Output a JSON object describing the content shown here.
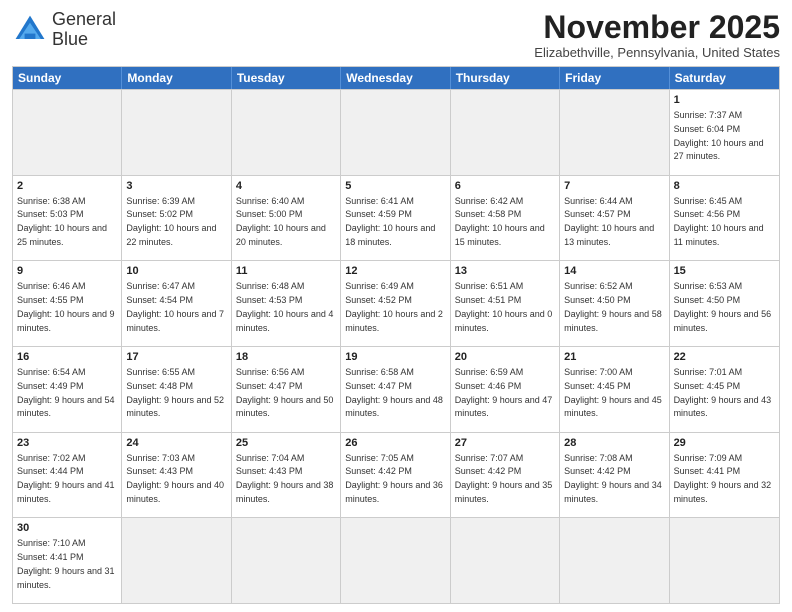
{
  "header": {
    "logo_line1": "General",
    "logo_line2": "Blue",
    "month_title": "November 2025",
    "location": "Elizabethville, Pennsylvania, United States"
  },
  "day_headers": [
    "Sunday",
    "Monday",
    "Tuesday",
    "Wednesday",
    "Thursday",
    "Friday",
    "Saturday"
  ],
  "weeks": [
    [
      {
        "day": "",
        "empty": true
      },
      {
        "day": "",
        "empty": true
      },
      {
        "day": "",
        "empty": true
      },
      {
        "day": "",
        "empty": true
      },
      {
        "day": "",
        "empty": true
      },
      {
        "day": "",
        "empty": true
      },
      {
        "day": "1",
        "sunrise": "7:37 AM",
        "sunset": "6:04 PM",
        "daylight": "10 hours and 27 minutes."
      }
    ],
    [
      {
        "day": "2",
        "sunrise": "6:38 AM",
        "sunset": "5:03 PM",
        "daylight": "10 hours and 25 minutes."
      },
      {
        "day": "3",
        "sunrise": "6:39 AM",
        "sunset": "5:02 PM",
        "daylight": "10 hours and 22 minutes."
      },
      {
        "day": "4",
        "sunrise": "6:40 AM",
        "sunset": "5:00 PM",
        "daylight": "10 hours and 20 minutes."
      },
      {
        "day": "5",
        "sunrise": "6:41 AM",
        "sunset": "4:59 PM",
        "daylight": "10 hours and 18 minutes."
      },
      {
        "day": "6",
        "sunrise": "6:42 AM",
        "sunset": "4:58 PM",
        "daylight": "10 hours and 15 minutes."
      },
      {
        "day": "7",
        "sunrise": "6:44 AM",
        "sunset": "4:57 PM",
        "daylight": "10 hours and 13 minutes."
      },
      {
        "day": "8",
        "sunrise": "6:45 AM",
        "sunset": "4:56 PM",
        "daylight": "10 hours and 11 minutes."
      }
    ],
    [
      {
        "day": "9",
        "sunrise": "6:46 AM",
        "sunset": "4:55 PM",
        "daylight": "10 hours and 9 minutes."
      },
      {
        "day": "10",
        "sunrise": "6:47 AM",
        "sunset": "4:54 PM",
        "daylight": "10 hours and 7 minutes."
      },
      {
        "day": "11",
        "sunrise": "6:48 AM",
        "sunset": "4:53 PM",
        "daylight": "10 hours and 4 minutes."
      },
      {
        "day": "12",
        "sunrise": "6:49 AM",
        "sunset": "4:52 PM",
        "daylight": "10 hours and 2 minutes."
      },
      {
        "day": "13",
        "sunrise": "6:51 AM",
        "sunset": "4:51 PM",
        "daylight": "10 hours and 0 minutes."
      },
      {
        "day": "14",
        "sunrise": "6:52 AM",
        "sunset": "4:50 PM",
        "daylight": "9 hours and 58 minutes."
      },
      {
        "day": "15",
        "sunrise": "6:53 AM",
        "sunset": "4:50 PM",
        "daylight": "9 hours and 56 minutes."
      }
    ],
    [
      {
        "day": "16",
        "sunrise": "6:54 AM",
        "sunset": "4:49 PM",
        "daylight": "9 hours and 54 minutes."
      },
      {
        "day": "17",
        "sunrise": "6:55 AM",
        "sunset": "4:48 PM",
        "daylight": "9 hours and 52 minutes."
      },
      {
        "day": "18",
        "sunrise": "6:56 AM",
        "sunset": "4:47 PM",
        "daylight": "9 hours and 50 minutes."
      },
      {
        "day": "19",
        "sunrise": "6:58 AM",
        "sunset": "4:47 PM",
        "daylight": "9 hours and 48 minutes."
      },
      {
        "day": "20",
        "sunrise": "6:59 AM",
        "sunset": "4:46 PM",
        "daylight": "9 hours and 47 minutes."
      },
      {
        "day": "21",
        "sunrise": "7:00 AM",
        "sunset": "4:45 PM",
        "daylight": "9 hours and 45 minutes."
      },
      {
        "day": "22",
        "sunrise": "7:01 AM",
        "sunset": "4:45 PM",
        "daylight": "9 hours and 43 minutes."
      }
    ],
    [
      {
        "day": "23",
        "sunrise": "7:02 AM",
        "sunset": "4:44 PM",
        "daylight": "9 hours and 41 minutes."
      },
      {
        "day": "24",
        "sunrise": "7:03 AM",
        "sunset": "4:43 PM",
        "daylight": "9 hours and 40 minutes."
      },
      {
        "day": "25",
        "sunrise": "7:04 AM",
        "sunset": "4:43 PM",
        "daylight": "9 hours and 38 minutes."
      },
      {
        "day": "26",
        "sunrise": "7:05 AM",
        "sunset": "4:42 PM",
        "daylight": "9 hours and 36 minutes."
      },
      {
        "day": "27",
        "sunrise": "7:07 AM",
        "sunset": "4:42 PM",
        "daylight": "9 hours and 35 minutes."
      },
      {
        "day": "28",
        "sunrise": "7:08 AM",
        "sunset": "4:42 PM",
        "daylight": "9 hours and 34 minutes."
      },
      {
        "day": "29",
        "sunrise": "7:09 AM",
        "sunset": "4:41 PM",
        "daylight": "9 hours and 32 minutes."
      }
    ],
    [
      {
        "day": "30",
        "sunrise": "7:10 AM",
        "sunset": "4:41 PM",
        "daylight": "9 hours and 31 minutes."
      },
      {
        "day": "",
        "empty": true
      },
      {
        "day": "",
        "empty": true
      },
      {
        "day": "",
        "empty": true
      },
      {
        "day": "",
        "empty": true
      },
      {
        "day": "",
        "empty": true
      },
      {
        "day": "",
        "empty": true
      }
    ]
  ]
}
